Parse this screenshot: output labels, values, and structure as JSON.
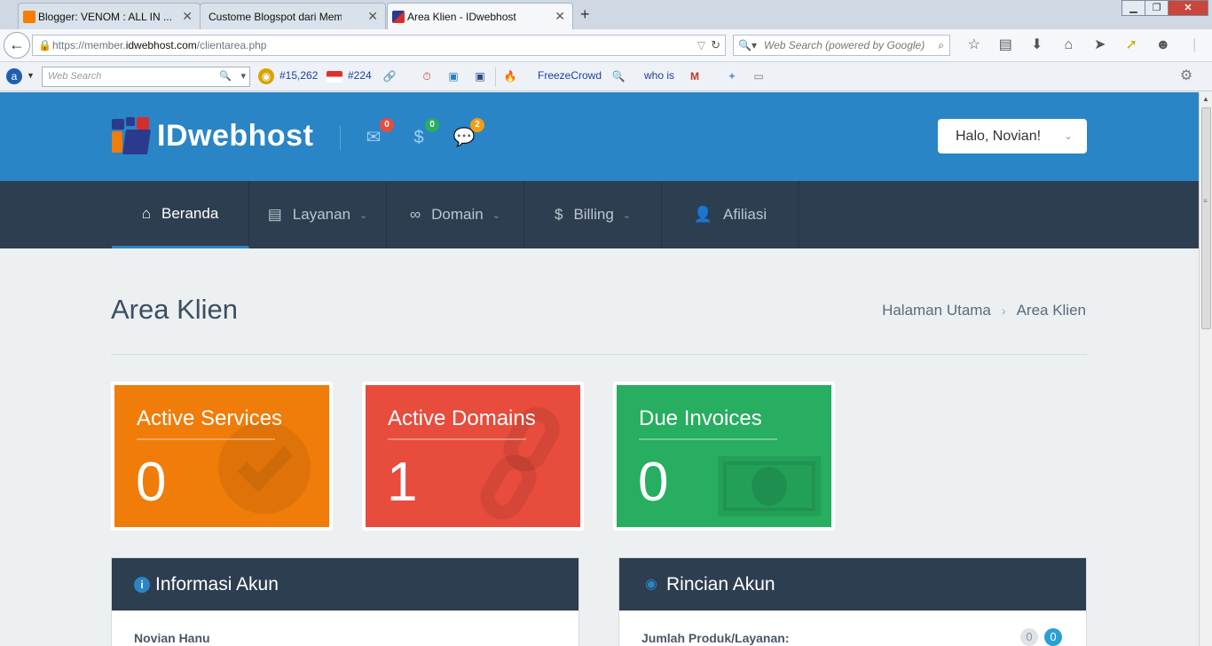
{
  "browser": {
    "tabs": [
      {
        "title": "Blogger: VENOM : ALL IN ...",
        "active": false
      },
      {
        "title": "Custome Blogspot dari Membe...",
        "active": false
      },
      {
        "title": "Area Klien - IDwebhost",
        "active": true
      }
    ],
    "url_prefix": "https://member.",
    "url_host": "idwebhost.com",
    "url_path": "/clientarea.php",
    "search_placeholder": "Web Search (powered by Google)"
  },
  "bookmarks": {
    "search_placeholder": "Web Search",
    "alexa_global": "#15,262",
    "alexa_country": "#224",
    "freezecrowd": "FreezeCrowd",
    "whois": "who is"
  },
  "header": {
    "brand": "IDwebhost",
    "email_badge": "0",
    "billing_badge": "0",
    "tickets_badge": "2",
    "user_greeting": "Halo, Novian!"
  },
  "nav": {
    "items": [
      {
        "label": "Beranda",
        "icon": "home-icon",
        "active": true
      },
      {
        "label": "Layanan",
        "icon": "services-icon",
        "dropdown": true
      },
      {
        "label": "Domain",
        "icon": "binoculars-icon",
        "dropdown": true
      },
      {
        "label": "Billing",
        "icon": "dollar-icon",
        "dropdown": true
      },
      {
        "label": "Afiliasi",
        "icon": "user-icon",
        "dropdown": false
      }
    ]
  },
  "page": {
    "title": "Area Klien",
    "breadcrumb_home": "Halaman Utama",
    "breadcrumb_current": "Area Klien"
  },
  "stats": [
    {
      "label": "Active Services",
      "value": "0",
      "color": "#f07c0a"
    },
    {
      "label": "Active Domains",
      "value": "1",
      "color": "#e74c3c"
    },
    {
      "label": "Due Invoices",
      "value": "0",
      "color": "#27ae60"
    }
  ],
  "panels": {
    "info_title": "Informasi Akun",
    "info_name": "Novian Hanu",
    "details_title": "Rincian Akun",
    "details_label": "Jumlah Produk/Layanan:",
    "details_count_total": "0",
    "details_count_active": "0"
  },
  "colors": {
    "header_blue": "#2a85c6",
    "nav_dark": "#2d3e50",
    "badge_red": "#e74c3c",
    "badge_green": "#27ae60",
    "badge_orange": "#f39c12"
  }
}
